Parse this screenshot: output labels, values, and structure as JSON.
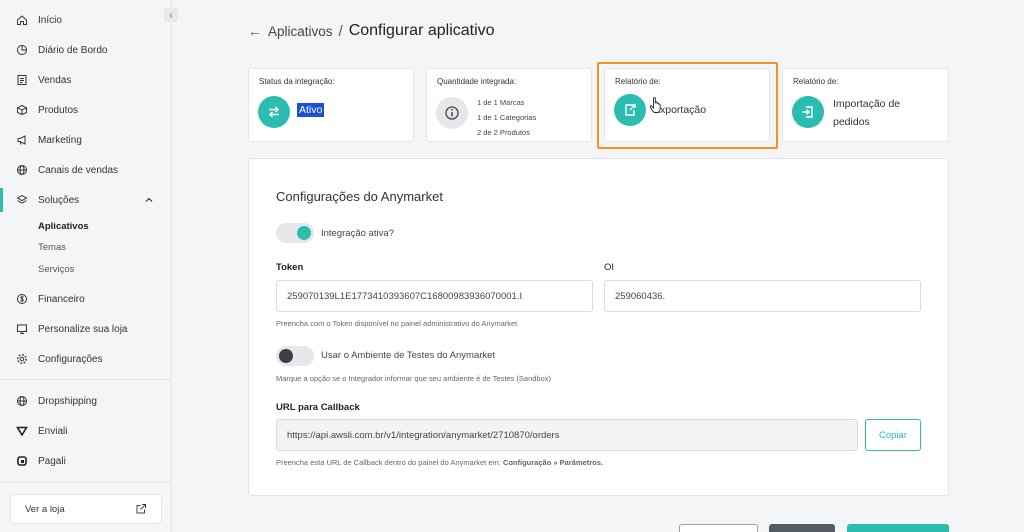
{
  "sidebar": {
    "items": [
      {
        "label": "Início",
        "icon": "home-icon"
      },
      {
        "label": "Diário de Bordo",
        "icon": "chart-pie-icon"
      },
      {
        "label": "Vendas",
        "icon": "receipt-icon"
      },
      {
        "label": "Produtos",
        "icon": "box-icon"
      },
      {
        "label": "Marketing",
        "icon": "megaphone-icon"
      },
      {
        "label": "Canais de vendas",
        "icon": "globe-icon"
      },
      {
        "label": "Soluções",
        "icon": "layers-icon"
      },
      {
        "label": "Financeiro",
        "icon": "dollar-circle-icon"
      },
      {
        "label": "Personalize sua loja",
        "icon": "monitor-icon"
      },
      {
        "label": "Configurações",
        "icon": "gear-icon"
      },
      {
        "label": "Dropshipping",
        "icon": "globe-icon"
      },
      {
        "label": "Enviali",
        "icon": "enviali-logo-icon"
      },
      {
        "label": "Pagali",
        "icon": "pagali-logo-icon"
      }
    ],
    "sub_items": [
      "Aplicativos",
      "Temas",
      "Serviços"
    ],
    "ver_loja": "Ver a loja"
  },
  "header": {
    "breadcrumb": "Aplicativos",
    "separator": "/",
    "title": "Configurar aplicativo"
  },
  "cards": {
    "status": {
      "label": "Status da integração:",
      "value": "Ativo"
    },
    "quantity": {
      "label": "Quantidade integrada:",
      "lines": [
        "1 de 1 Marcas",
        "1 de 1 Categorias",
        "2 de 2 Produtos"
      ]
    },
    "export_report": {
      "label": "Relatório de:",
      "value": "Exportação"
    },
    "import_report": {
      "label": "Relatório de:",
      "value_line1": "Importação de",
      "value_line2": "pedidos"
    }
  },
  "config": {
    "title": "Configurações do Anymarket",
    "integration_toggle_label": "Integração ativa?",
    "integration_active": true,
    "token_label": "Token",
    "token_value": "259070139L1E1773410393607C16800983936070001.I",
    "token_help": "Preencha com o Token disponível no painel administrativo do Anymarket",
    "oi_label": "OI",
    "oi_value": "259060436.",
    "sandbox_toggle_label": "Usar o Ambiente de Testes do Anymarket",
    "sandbox_active": false,
    "sandbox_help": "Marque a opção se o Integrador informar que seu ambiente é de Testes (Sandbox)",
    "callback_label": "URL para Callback",
    "callback_value": "https://api.awsli.com.br/v1/integration/anymarket/2710870/orders",
    "copy_label": "Copiar",
    "callback_help_prefix": "Preencha esta URL de Callback dentro do painel do Anymarket em: ",
    "callback_help_path": "Configuração » Parâmetros."
  },
  "colors": {
    "accent": "#2bbdb0",
    "highlight": "#f39223",
    "selection": "#1c4ed8"
  }
}
